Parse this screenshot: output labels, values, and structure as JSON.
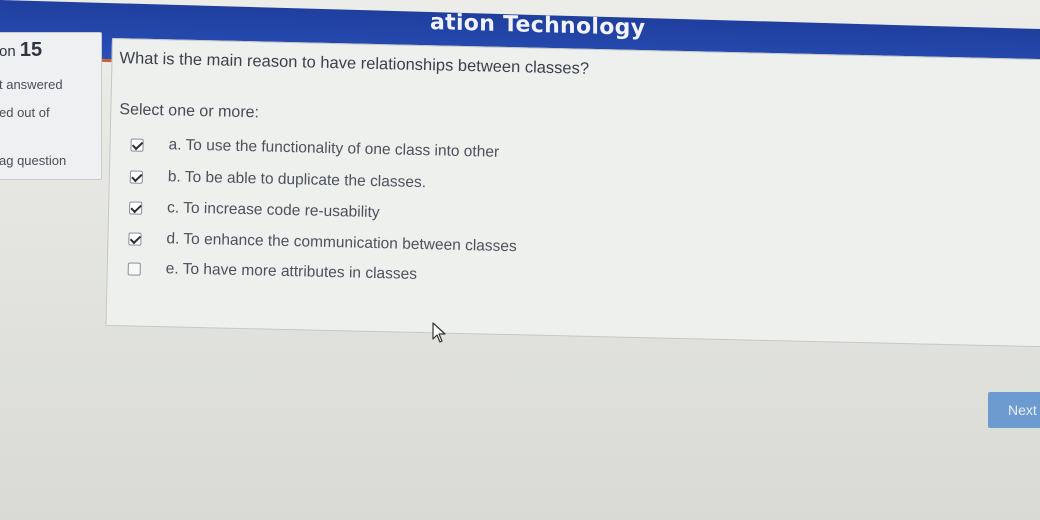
{
  "header": {
    "title": "ation Technology",
    "colors": {
      "bar": "#2a4fb8",
      "accent_line": "#c9623a"
    }
  },
  "info": {
    "question_prefix": "on",
    "question_number": "15",
    "status": "t answered",
    "marked_out_of": "ed out of",
    "flag_question": "ag question"
  },
  "question": {
    "text": "What is the main reason to have relationships between classes?",
    "prompt": "Select one or more:",
    "options": [
      {
        "label": "a. To use the functionality of one class into other",
        "checked": true
      },
      {
        "label": "b. To be able to duplicate the classes.",
        "checked": true
      },
      {
        "label": "c. To increase code re-usability",
        "checked": true
      },
      {
        "label": "d. To enhance the communication between classes",
        "checked": true
      },
      {
        "label": "e. To have more attributes in classes",
        "checked": false
      }
    ]
  },
  "navigation": {
    "next_label": "Next",
    "button_color": "#6d9bd0"
  },
  "icons": {
    "cursor": "mouse-pointer-icon",
    "checkbox": "checkbox-icon"
  }
}
